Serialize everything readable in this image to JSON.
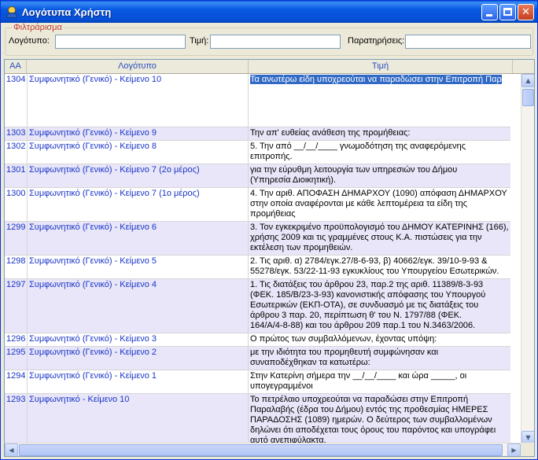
{
  "window": {
    "title": "Λογότυπα Χρήστη"
  },
  "filter": {
    "legend": "Φιλτράρισμα",
    "logotypo_label": "Λογότυπο:",
    "logotypo_value": "",
    "timi_label": "Τιμή:",
    "timi_value": "",
    "parat_label": "Παρατηρήσεις:",
    "parat_value": ""
  },
  "table": {
    "columns": [
      "ΑΑ",
      "Λογότυπο",
      "Τιμή"
    ],
    "rows": [
      {
        "aa": "1304",
        "logotypo": "Συμφωνητικό (Γενικό) - Κείμενο 10",
        "timi": [
          "Τα ανωτέρω είδη υποχρεούται να παραδώσει στην Επιτροπή Παρ"
        ],
        "selected": true
      },
      {
        "aa": "1303",
        "logotypo": "Συμφωνητικό (Γενικό) - Κείμενο 9",
        "timi": [
          "Την απ' ευθείας ανάθεση της προμήθειας:"
        ]
      },
      {
        "aa": "1302",
        "logotypo": "Συμφωνητικό (Γενικό) - Κείμενο 8",
        "timi": [
          "5. Την από __/__/____ γνωμοδότηση της αναφερόμενης",
          "επιτροπής."
        ]
      },
      {
        "aa": "1301",
        "logotypo": "Συμφωνητικό (Γενικό) - Κείμενο 7 (2ο μέρος)",
        "timi": [
          "για την εύρυθμη λειτουργία των υπηρεσιών του Δήμου",
          "(Υπηρεσία Διοικητική)."
        ]
      },
      {
        "aa": "1300",
        "logotypo": "Συμφωνητικό (Γενικό) - Κείμενο 7 (1ο μέρος)",
        "timi": [
          "4. Την αριθ. ΑΠΟΦΑΣΗ ΔΗΜΑΡΧΟΥ (1090) απόφαση ΔΗΜΑΡΧΟΥ",
          "στην οποία αναφέρονται με κάθε λεπτομέρεια τα είδη της",
          "προμήθειας"
        ]
      },
      {
        "aa": "1299",
        "logotypo": "Συμφωνητικό (Γενικό) - Κείμενο 6",
        "timi": [
          "3. Τον εγκεκριμένο προϋπολογισμό του ΔΗΜΟΥ ΚΑΤΕΡΙΝΗΣ (166),",
          "χρήσης 2009 και τις γραμμένες στους Κ.Α. πιστώσεις για την",
          "εκτέλεση των προμηθειών."
        ]
      },
      {
        "aa": "1298",
        "logotypo": "Συμφωνητικό (Γενικό) - Κείμενο 5",
        "timi": [
          "2. Τις αριθ. α) 2784/εγκ.27/8-6-93, β) 40662/εγκ. 39/10-9-93 &",
          "55278/εγκ. 53/22-11-93 εγκυκλίους του Υπουργείου Εσωτερικών."
        ]
      },
      {
        "aa": "1297",
        "logotypo": "Συμφωνητικό (Γενικό) - Κείμενο 4",
        "timi": [
          "1. Τις διατάξεις του άρθρου 23, παρ.2 της αριθ. 11389/8-3-93",
          "(ΦΕΚ. 185/Β/23-3-93) κανονιστικής απόφασης του Υπουργού",
          "Εσωτερικών (ΕΚΠ-ΟΤΑ), σε συνδυασμό με τις διατάξεις του",
          "άρθρου 3 παρ. 20, περίπτωση θ' του Ν. 1797/88 (ΦΕΚ.",
          "164/Α/4-8-88) και του άρθρου 209 παρ.1 του Ν.3463/2006."
        ]
      },
      {
        "aa": "1296",
        "logotypo": "Συμφωνητικό (Γενικό) - Κείμενο 3",
        "timi": [
          "Ο πρώτος των συμβαλλόμενων, έχοντας υπόψη:"
        ]
      },
      {
        "aa": "1295",
        "logotypo": "Συμφωνητικό (Γενικό) - Κείμενο 2",
        "timi": [
          "με την ιδιότητα του προμηθευτή συμφώνησαν και",
          "συναποδέχθηκαν τα κατωτέρω:"
        ]
      },
      {
        "aa": "1294",
        "logotypo": "Συμφωνητικό (Γενικό) - Κείμενο 1",
        "timi": [
          "Στην Κατερίνη σήμερα την __/__/____ και ώρα _____, οι",
          "υπογεγραμμένοι"
        ]
      },
      {
        "aa": "1293",
        "logotypo": "Συμφωνητικό - Κείμενο 10",
        "timi": [
          "Το πετρέλαιο υποχρεούται να παραδώσει στην Επιτροπή",
          "Παραλαβής (έδρα του Δήμου) εντός της προθεσμίας ΗΜΕΡΕΣ",
          "ΠΑΡΑΔΟΣΗΣ (1089) ημερών. Ο δεύτερος των συμβαλλομένων",
          "δηλώνει ότι αποδέχεται τους όρους του παρόντος και υπογράφει",
          "αυτό ανεπιφύλακτα."
        ]
      }
    ]
  },
  "icons": {
    "app": "user-icon",
    "minimize": "minimize-icon",
    "maximize": "maximize-icon",
    "close": "close-icon"
  },
  "colors": {
    "titlebar": "#0858e0",
    "selection": "#316ac5",
    "alt_row": "#e8e6f8",
    "link_text": "#1a35c8",
    "legend": "#c0392b"
  }
}
